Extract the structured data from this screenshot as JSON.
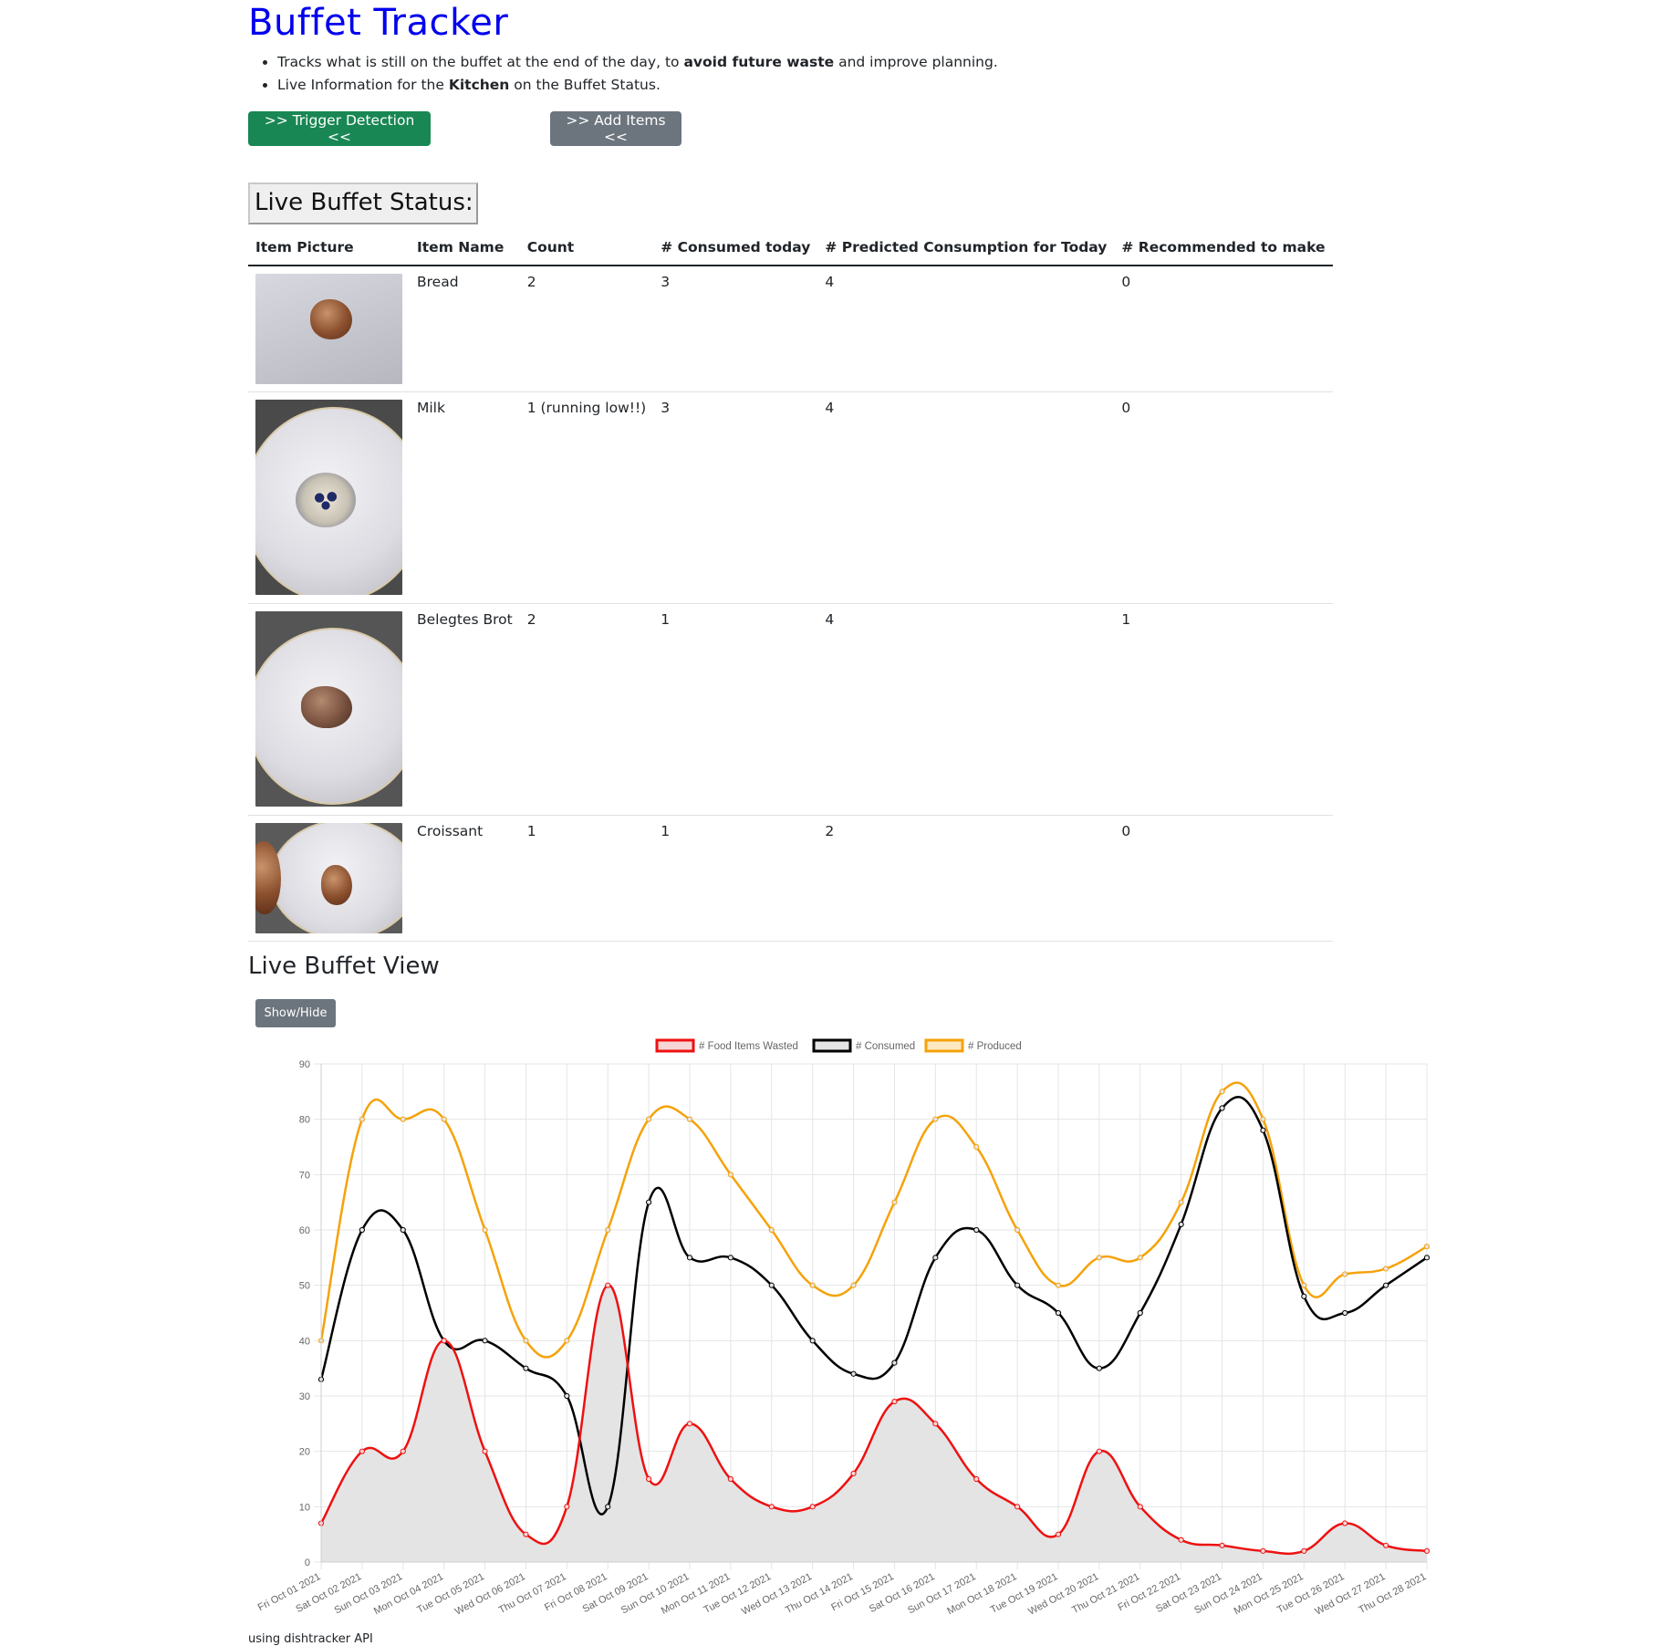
{
  "header": {
    "title": "Buffet Tracker",
    "bullets": [
      {
        "pre": "Tracks what is still on the buffet at the end of the day, to ",
        "bold": "avoid future waste",
        "post": " and improve planning."
      },
      {
        "pre": "Live Information for the ",
        "bold": "Kitchen",
        "post": " on the Buffet Status."
      }
    ]
  },
  "buttons": {
    "trigger": ">> Trigger Detection <<",
    "add": ">> Add Items <<",
    "show_hide": "Show/Hide"
  },
  "status": {
    "heading": "Live Buffet Status:",
    "columns": [
      "Item Picture",
      "Item Name",
      "Count",
      "# Consumed today",
      "# Predicted Consumption for Today",
      "# Recommended to make"
    ],
    "rows": [
      {
        "name": "Bread",
        "count": "2",
        "consumed": "3",
        "predicted": "4",
        "recommended": "0",
        "picture": "bread-picture"
      },
      {
        "name": "Milk",
        "count": "1 (running low!!)",
        "consumed": "3",
        "predicted": "4",
        "recommended": "0",
        "picture": "milk-picture"
      },
      {
        "name": "Belegtes Brot",
        "count": "2",
        "consumed": "1",
        "predicted": "4",
        "recommended": "1",
        "picture": "belegtes-brot-picture"
      },
      {
        "name": "Croissant",
        "count": "1",
        "consumed": "1",
        "predicted": "2",
        "recommended": "0",
        "picture": "croissant-picture"
      }
    ]
  },
  "view": {
    "heading": "Live Buffet View"
  },
  "footer": {
    "text": "using dishtracker API"
  },
  "chart_data": {
    "type": "line",
    "ylim": [
      0,
      90
    ],
    "yticks": [
      0,
      10,
      20,
      30,
      40,
      50,
      60,
      70,
      80,
      90
    ],
    "grid": true,
    "legend_position": "top",
    "categories": [
      "Fri Oct 01 2021",
      "Sat Oct 02 2021",
      "Sun Oct 03 2021",
      "Mon Oct 04 2021",
      "Tue Oct 05 2021",
      "Wed Oct 06 2021",
      "Thu Oct 07 2021",
      "Fri Oct 08 2021",
      "Sat Oct 09 2021",
      "Sun Oct 10 2021",
      "Mon Oct 11 2021",
      "Tue Oct 12 2021",
      "Wed Oct 13 2021",
      "Thu Oct 14 2021",
      "Fri Oct 15 2021",
      "Sat Oct 16 2021",
      "Sun Oct 17 2021",
      "Mon Oct 18 2021",
      "Tue Oct 19 2021",
      "Wed Oct 20 2021",
      "Thu Oct 21 2021",
      "Fri Oct 22 2021",
      "Sat Oct 23 2021",
      "Sun Oct 24 2021",
      "Mon Oct 25 2021",
      "Tue Oct 26 2021",
      "Wed Oct 27 2021",
      "Thu Oct 28 2021"
    ],
    "series": [
      {
        "name": "# Food Items Wasted",
        "color": "#ee1111",
        "fill": "#e4e4e4",
        "values": [
          7,
          20,
          20,
          40,
          20,
          5,
          10,
          50,
          15,
          25,
          15,
          10,
          10,
          16,
          29,
          25,
          15,
          10,
          5,
          20,
          10,
          4,
          3,
          2,
          2,
          7,
          3,
          2
        ]
      },
      {
        "name": "# Consumed",
        "color": "#000000",
        "values": [
          33,
          60,
          60,
          40,
          40,
          35,
          30,
          10,
          65,
          55,
          55,
          50,
          40,
          34,
          36,
          55,
          60,
          50,
          45,
          35,
          45,
          61,
          82,
          78,
          48,
          45,
          50,
          55
        ]
      },
      {
        "name": "# Produced",
        "color": "#f5a20a",
        "values": [
          40,
          80,
          80,
          80,
          60,
          40,
          40,
          60,
          80,
          80,
          70,
          60,
          50,
          50,
          65,
          80,
          75,
          60,
          50,
          55,
          55,
          65,
          85,
          80,
          50,
          52,
          53,
          57
        ]
      }
    ]
  }
}
